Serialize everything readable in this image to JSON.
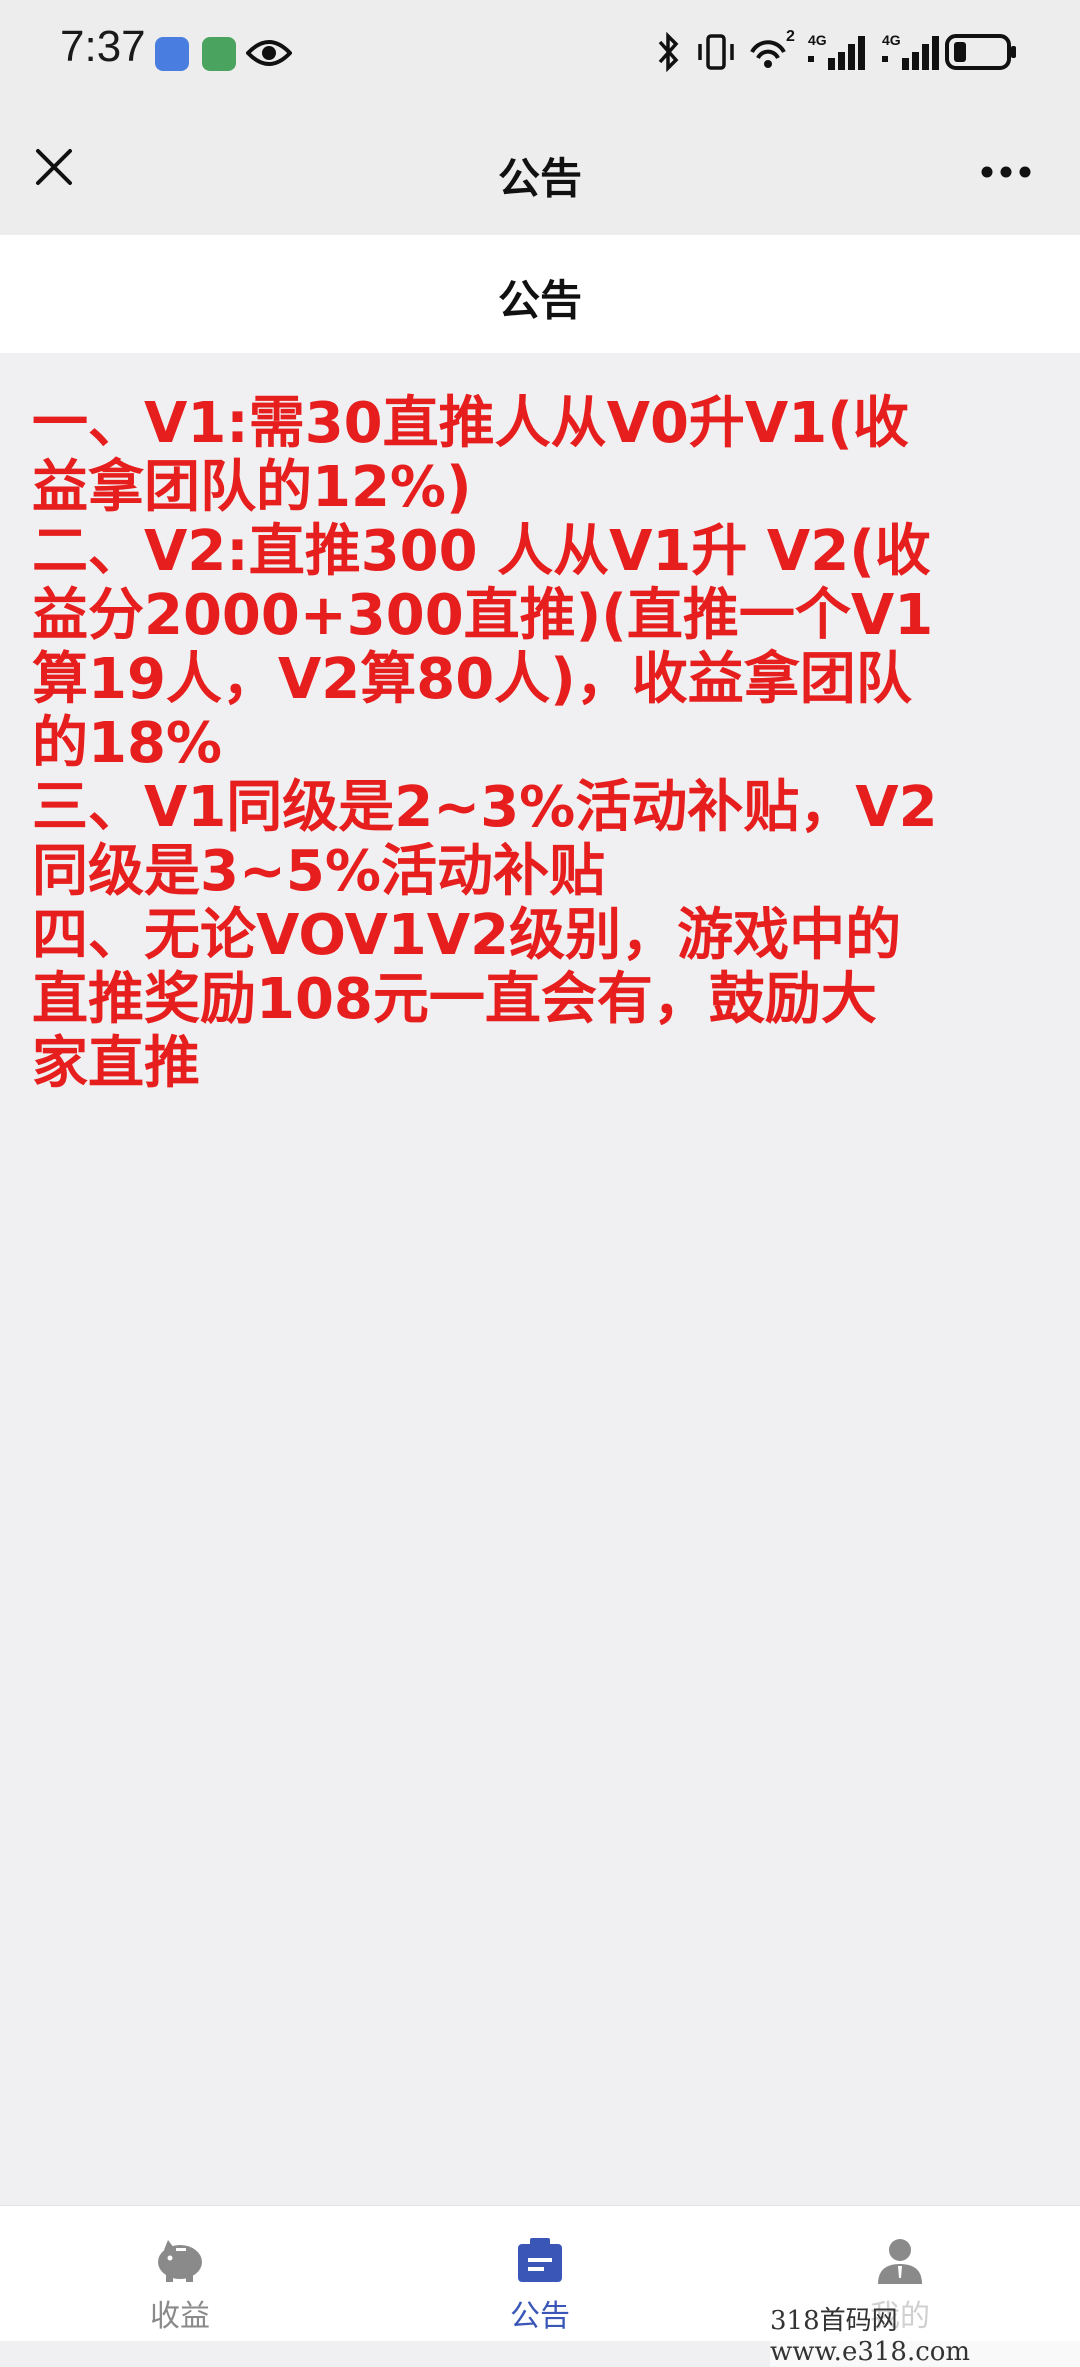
{
  "status_bar": {
    "time": "7:37",
    "network_label_1": "4G",
    "network_label_2": "4G",
    "wifi_label": "2",
    "icons": [
      "app-blue-icon",
      "app-green-icon",
      "eye-icon",
      "bluetooth-icon",
      "vibrate-icon",
      "wifi-icon",
      "signal-icon",
      "battery-icon"
    ]
  },
  "nav": {
    "title": "公告",
    "close_icon": "close-icon",
    "more_icon": "more-icon"
  },
  "section": {
    "title": "公告"
  },
  "notice": {
    "color": "#e61e1e",
    "lines": [
      "一、V1:需30直推人从V0升V1(收",
      "益拿团队的12%)",
      "二、V2:直推300 人从V1升 V2(收",
      "益分2000+300直推)(直推一个V1",
      "算19人，V2算80人)，收益拿团队",
      "的18%",
      "三、V1同级是2~3%活动补贴，V2",
      "同级是3~5%活动补贴",
      "四、无论VOV1V2级别，游戏中的",
      "直推奖励108元一直会有，鼓励大",
      "家直推"
    ]
  },
  "tabs": [
    {
      "label": "收益",
      "icon": "piggy-bank-icon",
      "active": false
    },
    {
      "label": "公告",
      "icon": "notice-icon",
      "active": true
    },
    {
      "label": "我的",
      "icon": "user-icon",
      "active": false
    }
  ],
  "colors": {
    "active_tab": "#3a57b8",
    "inactive_tab": "#8a8a8a",
    "notice_text": "#e61e1e"
  },
  "watermark": "318首码网 www.e318.com"
}
